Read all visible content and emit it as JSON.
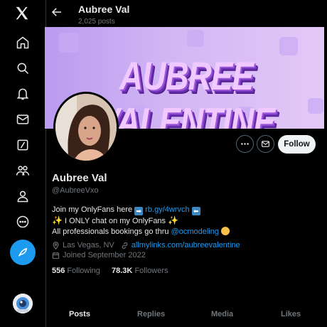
{
  "nav": {
    "items": [
      "x-logo",
      "home",
      "explore",
      "notifications",
      "messages",
      "grok",
      "communities",
      "profile",
      "more"
    ],
    "accent": "#1d9bf0"
  },
  "header": {
    "name": "Aubree Val",
    "posts_count": "2,025 posts"
  },
  "banner": {
    "text": "AUBREE VALENTINE"
  },
  "profile": {
    "display_name": "Aubree Val",
    "handle": "@AubreeVxo",
    "follow_label": "Follow",
    "bio": {
      "line1_prefix": "Join my OnlyFans here",
      "line1_link": "rb.gy/4wrvch",
      "line2": "I ONLY chat on my OnlyFans",
      "line3_prefix": "All professionals bookings go thru",
      "line3_mention": "@ocmodeling"
    },
    "location": "Las Vegas, NV",
    "website": "allmylinks.com/aubreevalentine",
    "joined": "Joined September 2022",
    "following_count": "556",
    "following_label": "Following",
    "followers_count": "78.3K",
    "followers_label": "Followers"
  },
  "tabs": [
    "Posts",
    "Replies",
    "Media",
    "Likes"
  ],
  "active_tab": "Posts"
}
